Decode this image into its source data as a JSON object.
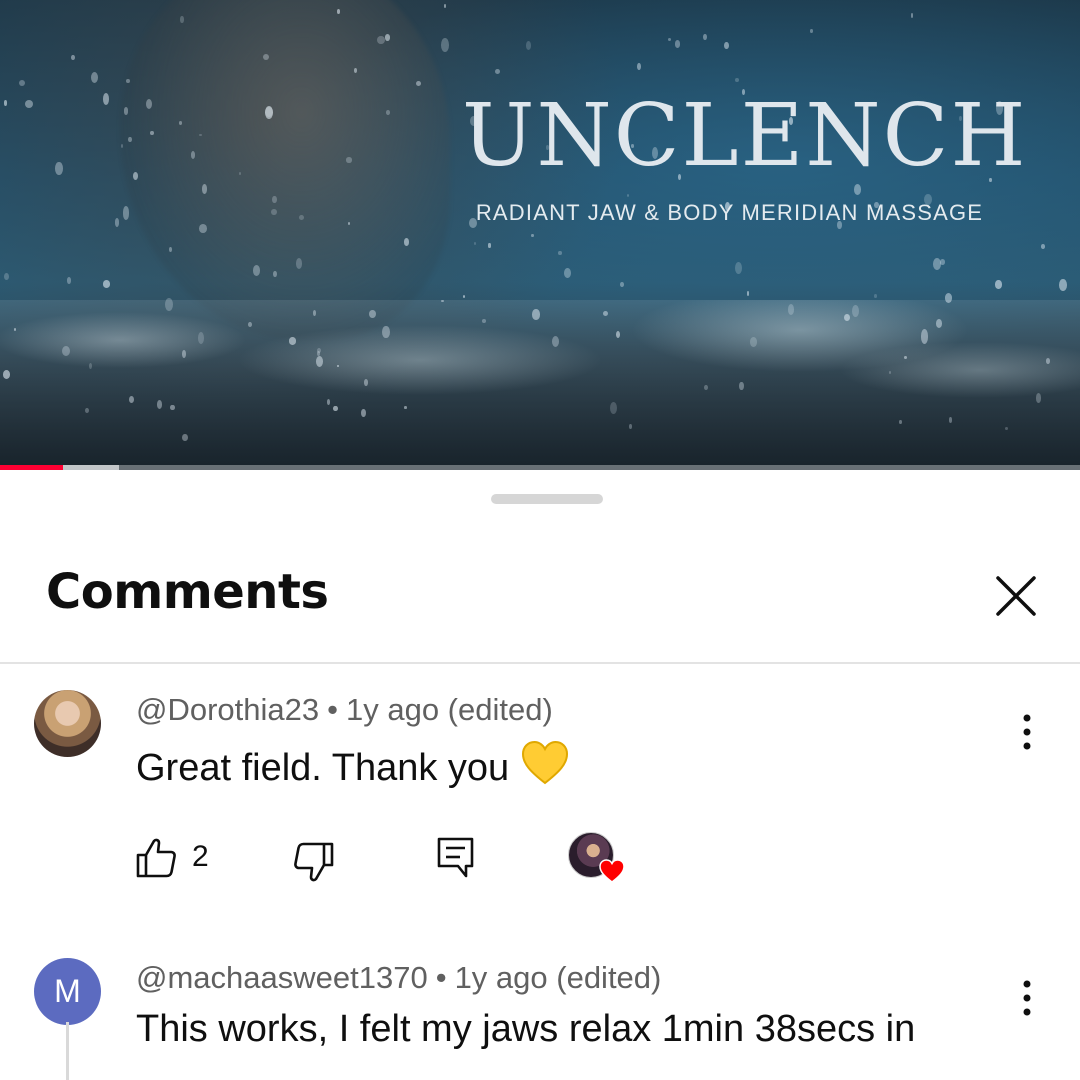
{
  "video": {
    "title": "UNCLENCH",
    "subtitle": "RADIANT JAW & BODY MERIDIAN MASSAGE",
    "progress_played": 0.058,
    "progress_buffered": 0.11,
    "accent_color": "#ff0033"
  },
  "comments_panel": {
    "title": "Comments",
    "close_icon": "close-icon",
    "comments": [
      {
        "author": "@Dorothia23",
        "age": "1y ago (edited)",
        "text": "Great field. Thank you",
        "emoji": "yellow-heart",
        "likes": "2",
        "creator_hearted": true
      },
      {
        "author": "@machaasweet1370",
        "avatar_letter": "M",
        "age": "1y ago (edited)",
        "text": "This works, I felt my jaws relax 1min 38secs in"
      }
    ]
  }
}
